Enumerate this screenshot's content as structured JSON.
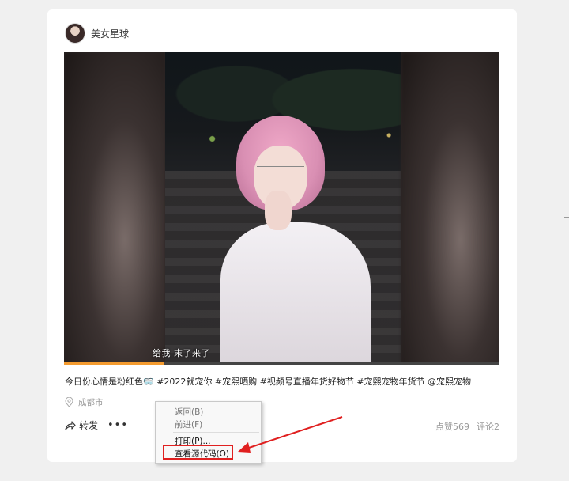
{
  "author": {
    "name": "美女星球"
  },
  "video": {
    "subtitle": "给我 末了来了",
    "progress": 0.23
  },
  "post": {
    "caption": "今日份心情是粉红色🥽 #2022就宠你 #宠熙晒购 #视频号直播年货好物节 #宠熙宠物年货节 @宠熙宠物",
    "location": "成都市"
  },
  "actions": {
    "share_label": "转发",
    "more_label": "•••"
  },
  "stats": {
    "likes": "点赞569",
    "comments": "评论2"
  },
  "context_menu": {
    "back": "返回(B)",
    "forward": "前进(F)",
    "print": "打印(P)...",
    "view_source": "查看源代码(O)"
  },
  "colors": {
    "accent": "#f49b2f",
    "annotation": "#e02020"
  },
  "icons": {
    "location": "pin-icon",
    "share": "share-icon"
  }
}
